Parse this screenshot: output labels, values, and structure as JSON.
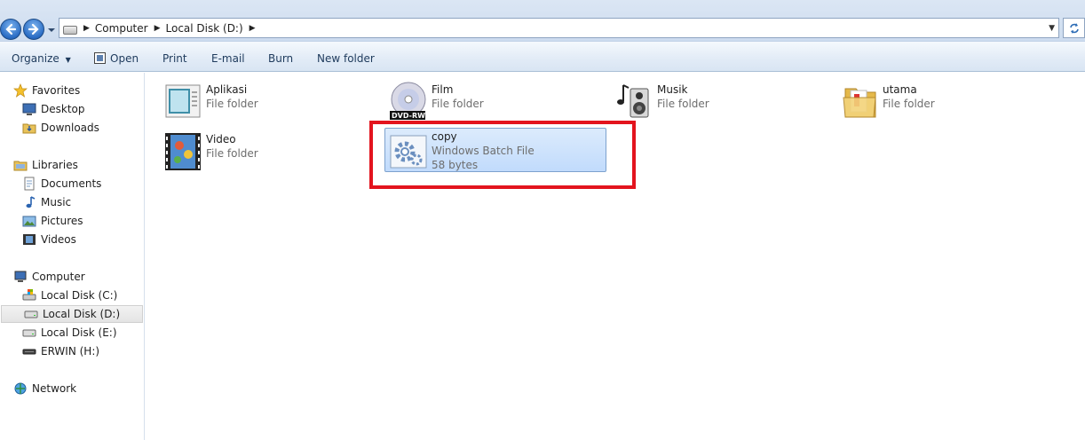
{
  "address": {
    "crumbs": [
      "Computer",
      "Local Disk (D:)"
    ]
  },
  "toolbar": {
    "organize": "Organize",
    "open": "Open",
    "print": "Print",
    "email": "E-mail",
    "burn": "Burn",
    "new_folder": "New folder"
  },
  "sidebar": {
    "favorites": "Favorites",
    "desktop": "Desktop",
    "downloads": "Downloads",
    "libraries": "Libraries",
    "documents": "Documents",
    "music": "Music",
    "pictures": "Pictures",
    "videos": "Videos",
    "computer": "Computer",
    "disk_c": "Local Disk (C:)",
    "disk_d": "Local Disk (D:)",
    "disk_e": "Local Disk (E:)",
    "erwin": "ERWIN (H:)",
    "network": "Network"
  },
  "items": [
    {
      "name": "Aplikasi",
      "type": "File folder"
    },
    {
      "name": "Film",
      "type": "File folder",
      "badge": "DVD-RW"
    },
    {
      "name": "Musik",
      "type": "File folder"
    },
    {
      "name": "utama",
      "type": "File folder"
    },
    {
      "name": "Video",
      "type": "File folder"
    },
    {
      "name": "copy",
      "type": "Windows Batch File",
      "size": "58 bytes"
    }
  ],
  "colors": {
    "highlight": "#e3141e",
    "selection": "#c1dbfc"
  }
}
